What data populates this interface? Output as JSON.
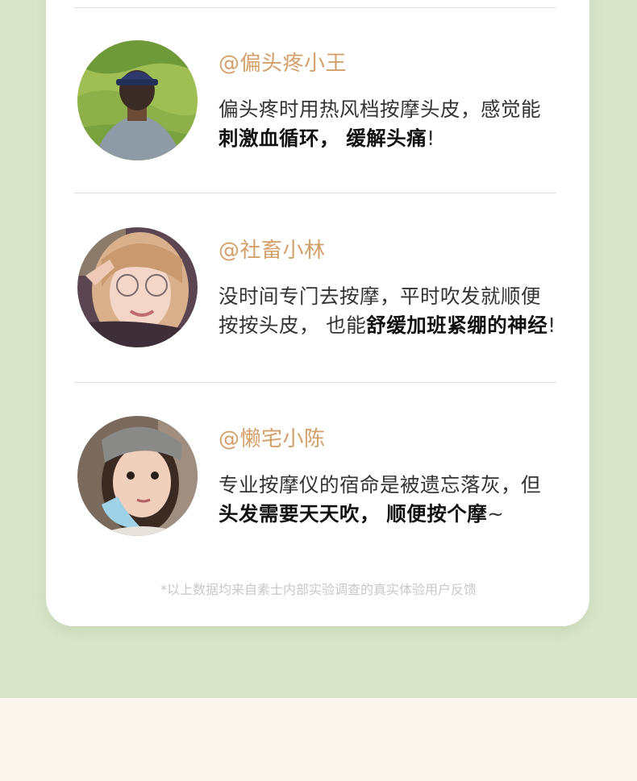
{
  "reviews": [
    {
      "username": "@偏头疼小王",
      "line1_plain": "偏头疼时用热风档按摩头皮，感觉能",
      "line2_bold_a": "刺激血循环，",
      "line2_plain_a": " ",
      "line2_bold_b": "缓解头痛",
      "line2_plain_b": "!"
    },
    {
      "username": "@社畜小林",
      "line1_plain": "没时间专门去按摩，平时吹发就顺便",
      "line2_plain_a": "按按头皮， 也能",
      "line2_bold_b": "舒缓加班紧绷的神经",
      "line2_plain_b": "!"
    },
    {
      "username": "@懒宅小陈",
      "line1_plain": "专业按摩仪的宿命是被遗忘落灰，但",
      "line2_bold_a": "头发需要天天吹，",
      "line2_plain_a": " ",
      "line2_bold_b": "顺便按个摩",
      "line2_plain_b": "~"
    }
  ],
  "footnote": "*以上数据均来自素士内部实验调查的真实体验用户反馈",
  "colors": {
    "page_background": "#d9e5cb",
    "card": "#ffffff",
    "username": "#d3a069",
    "bottom_band": "#fdf6ef"
  }
}
